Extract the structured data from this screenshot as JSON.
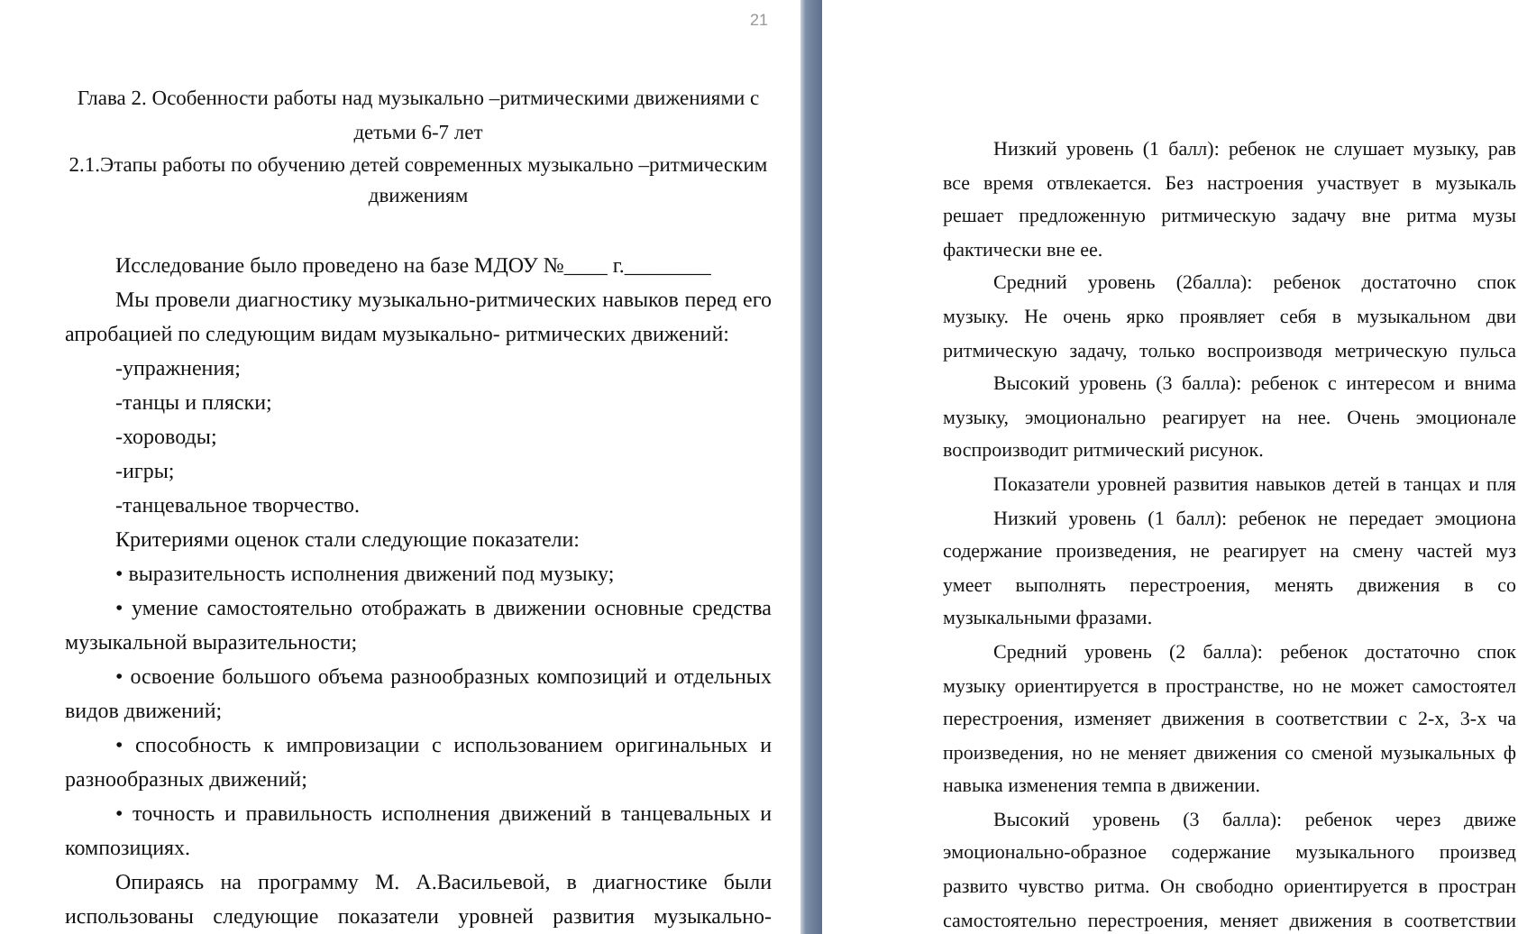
{
  "pages": [
    {
      "page_number": "21",
      "heading": [
        "Глава 2. Особенности работы над музыкально –ритмическими движениями с",
        "детьми 6-7 лет",
        "2.1.Этапы работы по обучению детей современных музыкально –ритмическим",
        "движениям"
      ],
      "lines": [
        {
          "text": "Исследование было проведено на базе МДОУ №____ г.________",
          "kind": "indent",
          "justified": false
        },
        {
          "text": "Мы провели диагностику музыкально-ритмических навыков перед его",
          "kind": "indent",
          "justified": true
        },
        {
          "text": "апробацией по следующим видам музыкально- ритмических движений:",
          "kind": "plain",
          "justified": false
        },
        {
          "text": "-упражнения;",
          "kind": "indent"
        },
        {
          "text": "-танцы и пляски;",
          "kind": "indent",
          "justified": false
        },
        {
          "text": "-хороводы;",
          "kind": "indent"
        },
        {
          "text": "-игры;",
          "kind": "indent"
        },
        {
          "text": "-танцевальное творчество.",
          "kind": "indent",
          "justified": false
        },
        {
          "text": "Критериями оценок стали следующие показатели:",
          "kind": "indent",
          "justified": false
        },
        {
          "text": "• выразительность исполнения движений под музыку;",
          "kind": "indent",
          "justified": false
        },
        {
          "text": "• умение самостоятельно отображать в движении основные средства",
          "kind": "indent",
          "justified": true
        },
        {
          "text": "музыкальной выразительности;",
          "kind": "plain",
          "justified": false
        },
        {
          "text": "• освоение большого объема разнообразных композиций и отдельных",
          "kind": "indent",
          "justified": true
        },
        {
          "text": "видов движений;",
          "kind": "plain",
          "justified": false
        },
        {
          "text": "• способность к импровизации с использованием оригинальных и",
          "kind": "indent",
          "justified": true
        },
        {
          "text": "разнообразных движений;",
          "kind": "plain",
          "justified": false
        },
        {
          "text": "• точность и правильность исполнения движений в танцевальных и",
          "kind": "indent",
          "justified": true
        },
        {
          "text": "композициях.",
          "kind": "plain"
        },
        {
          "text": "Опираясь на программу М. А.Васильевой, в диагностике были",
          "kind": "indent",
          "justified": true
        },
        {
          "text": "использованы следующие показатели уровней развития музыкально-",
          "kind": "plain",
          "justified": true
        }
      ]
    },
    {
      "lines": [
        {
          "text": "Низкий уровень (1 балл): ребенок не слушает музыку, рав",
          "kind": "indent",
          "justified": true
        },
        {
          "text": "все время отвлекается. Без настроения участвует в музыкаль",
          "kind": "plain",
          "justified": true
        },
        {
          "text": "решает предложенную ритмическую задачу вне ритма музы",
          "kind": "plain",
          "justified": true
        },
        {
          "text": "фактически вне ее.",
          "kind": "plain",
          "justified": false
        },
        {
          "text": "Средний уровень (2балла): ребенок достаточно спок",
          "kind": "indent",
          "justified": true
        },
        {
          "text": "музыку. Не очень ярко проявляет себя в музыкальном дви",
          "kind": "plain",
          "justified": true
        },
        {
          "text": "ритмическую задачу, только воспроизводя метрическую пульса",
          "kind": "plain",
          "justified": true
        },
        {
          "text": "Высокий уровень (3 балла): ребенок с интересом и внима",
          "kind": "indent",
          "justified": true
        },
        {
          "text": "музыку, эмоционально реагирует на нее. Очень эмоционале",
          "kind": "plain",
          "justified": true
        },
        {
          "text": "воспроизводит ритмический рисунок.",
          "kind": "plain",
          "justified": false
        },
        {
          "text": "Показатели уровней развития навыков детей в танцах и пля",
          "kind": "indent",
          "justified": true
        },
        {
          "text": "Низкий уровень (1 балл): ребенок не передает эмоциона",
          "kind": "indent",
          "justified": true
        },
        {
          "text": "содержание произведения, не реагирует на смену частей муз",
          "kind": "plain",
          "justified": true
        },
        {
          "text": "умеет выполнять перестроения, менять движения в со",
          "kind": "plain",
          "justified": true
        },
        {
          "text": "музыкальными фразами.",
          "kind": "plain",
          "justified": false
        },
        {
          "text": "Средний уровень (2 балла): ребенок достаточно спок",
          "kind": "indent",
          "justified": true
        },
        {
          "text": "музыку ориентируется в пространстве, но не может самостоятел",
          "kind": "plain",
          "justified": true
        },
        {
          "text": "перестроения, изменяет движения в соответствии с 2-х, 3-х ча",
          "kind": "plain",
          "justified": true
        },
        {
          "text": "произведения, но не меняет движения со сменой музыкальных ф",
          "kind": "plain",
          "justified": true
        },
        {
          "text": "навыка изменения темпа в движении.",
          "kind": "plain",
          "justified": false
        },
        {
          "text": "Высокий уровень (3 балла): ребенок через движе",
          "kind": "indent",
          "justified": true
        },
        {
          "text": "эмоционально-образное содержание музыкального произвед",
          "kind": "plain",
          "justified": true
        },
        {
          "text": "развито чувство ритма. Он свободно ориентируется в простран",
          "kind": "plain",
          "justified": true
        },
        {
          "text": "самостоятельно перестроения, меняет движения в соответствии",
          "kind": "plain",
          "justified": true
        }
      ]
    }
  ]
}
